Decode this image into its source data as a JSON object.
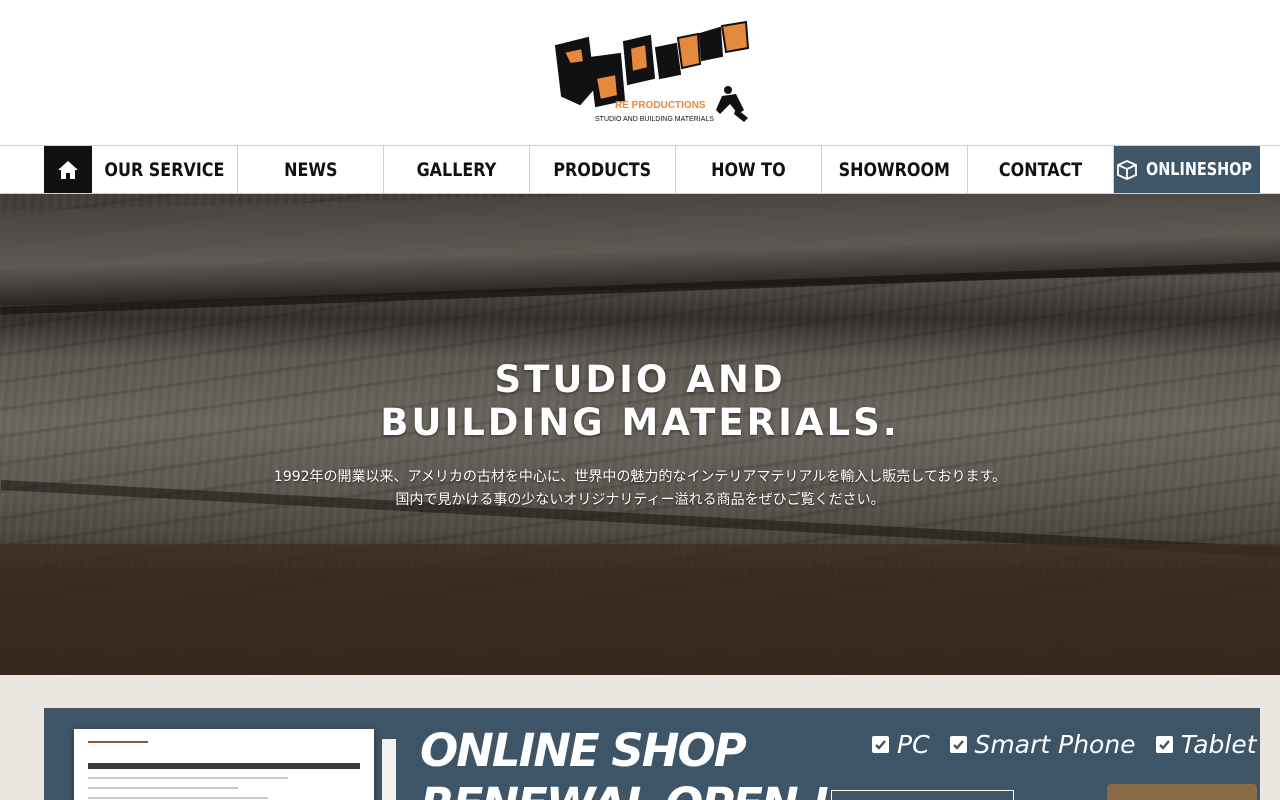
{
  "header": {
    "logo_text": "GALLUP",
    "logo_sub1": "RE PRODUCTIONS",
    "logo_sub2": "STUDIO AND BUILDING MATERIALS"
  },
  "nav": {
    "items": [
      {
        "label": "OUR SERVICE"
      },
      {
        "label": "NEWS"
      },
      {
        "label": "GALLERY"
      },
      {
        "label": "PRODUCTS"
      },
      {
        "label": "HOW TO"
      },
      {
        "label": "SHOWROOM"
      },
      {
        "label": "CONTACT"
      }
    ],
    "shop_label": "ONLINESHOP"
  },
  "hero": {
    "title_line1": "STUDIO AND",
    "title_line2": "BUILDING MATERIALS.",
    "text_line1": "1992年の開業以来、アメリカの古材を中心に、世界中の魅力的なインテリアマテリアルを輸入し販売しております。",
    "text_line2": "国内で見かける事の少ないオリジナリティー溢れる商品をぜひご覧ください。"
  },
  "banner": {
    "title": "ONLINE SHOP",
    "title2": "RENEWAL OPEN !",
    "devices": [
      "PC",
      "Smart Phone",
      "Tablet"
    ]
  },
  "colors": {
    "nav_shop_bg": "#3f5568",
    "banner_bg": "#3e5568",
    "lower_bg": "#ebe7e0",
    "logo_orange": "#e58a3c"
  }
}
